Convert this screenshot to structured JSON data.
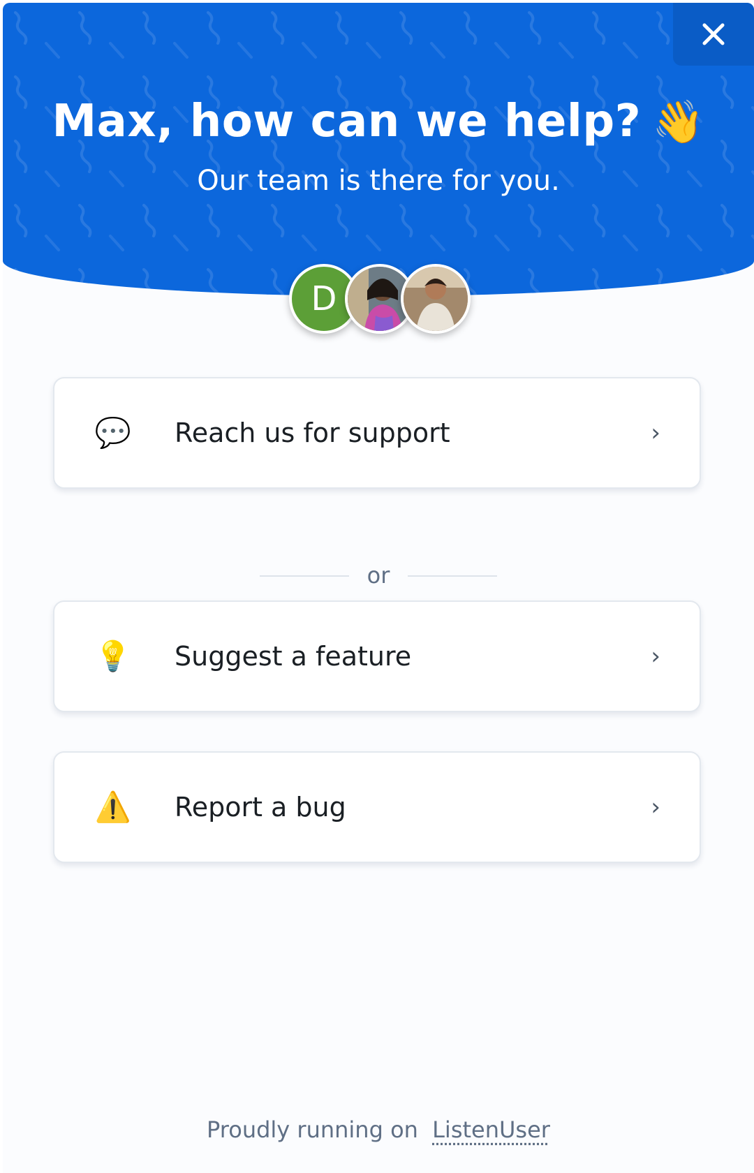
{
  "header": {
    "title": "Max, how can we help?",
    "title_emoji": "👋",
    "subtitle": "Our team is there for you.",
    "background_color": "#0c67dc"
  },
  "close_button": {
    "icon": "close-icon"
  },
  "team": {
    "avatars": [
      {
        "initial": "D",
        "color": "#5c9f37"
      },
      {
        "type": "photo"
      },
      {
        "type": "photo"
      }
    ]
  },
  "actions": [
    {
      "label": "Reach us for support",
      "icon": "speech-bubble-icon",
      "glyph": "💬"
    },
    {
      "label": "Suggest a feature",
      "icon": "lightbulb-icon",
      "glyph": "💡"
    },
    {
      "label": "Report a bug",
      "icon": "warning-icon",
      "glyph": "⚠️"
    }
  ],
  "divider": {
    "text": "or"
  },
  "footer": {
    "prefix": "Proudly running on",
    "brand": "ListenUser"
  }
}
